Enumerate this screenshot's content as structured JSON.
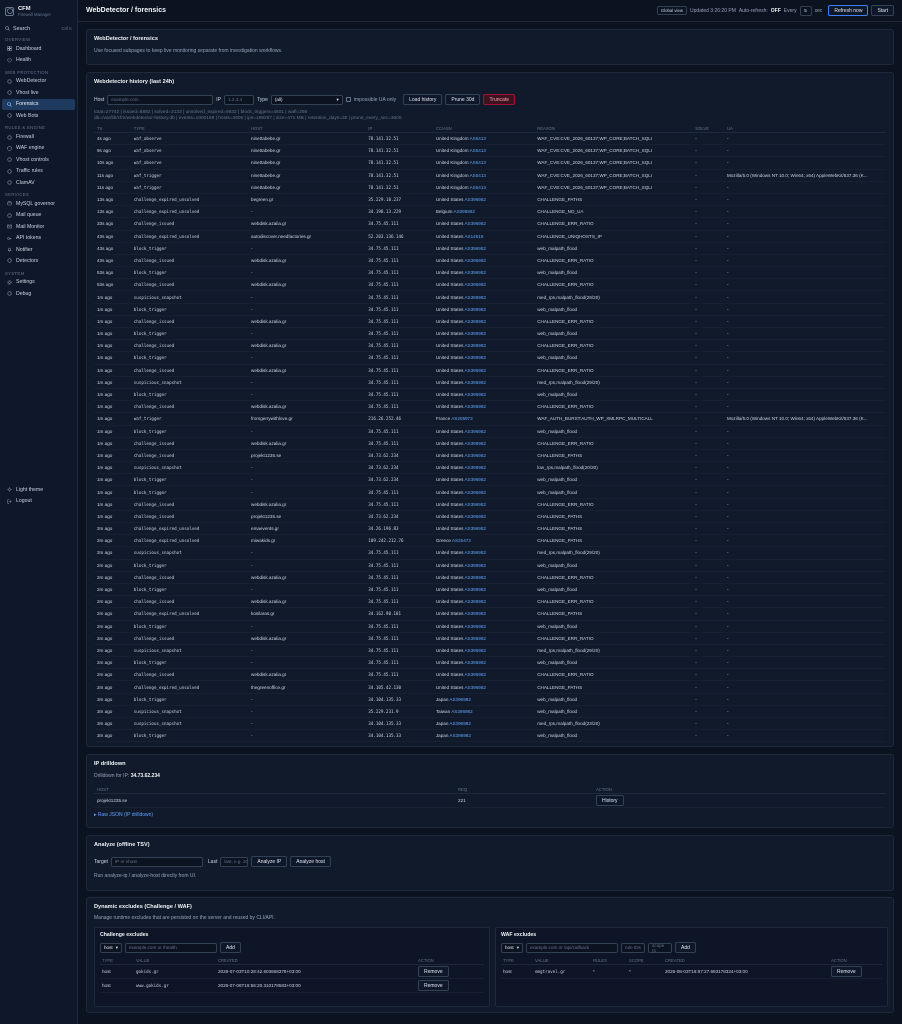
{
  "brand": {
    "title": "CFM",
    "subtitle": "Firewall Manager"
  },
  "sidebar": {
    "search_label": "Search",
    "search_kbd": "Ctrl K",
    "sections": [
      {
        "title": "Overview",
        "items": [
          {
            "label": "Dashboard",
            "icon": "grid-icon"
          },
          {
            "label": "Health",
            "icon": "heart-icon"
          }
        ]
      },
      {
        "title": "Web Protection",
        "items": [
          {
            "label": "WebDetector",
            "icon": "radar-icon"
          },
          {
            "label": "Vhost live",
            "icon": "pulse-icon"
          },
          {
            "label": "Forensics",
            "icon": "magnifier-icon",
            "active": true
          },
          {
            "label": "Web Bots",
            "icon": "bot-icon"
          }
        ]
      },
      {
        "title": "Rules & Engine",
        "items": [
          {
            "label": "Firewall",
            "icon": "flame-icon"
          },
          {
            "label": "WAF engine",
            "icon": "shield-icon"
          },
          {
            "label": "Vhost controls",
            "icon": "sliders-icon"
          },
          {
            "label": "Traffic rules",
            "icon": "route-icon"
          },
          {
            "label": "ClamAV",
            "icon": "bug-icon"
          }
        ]
      },
      {
        "title": "Services",
        "items": [
          {
            "label": "MySQL governor",
            "icon": "database-icon"
          },
          {
            "label": "Mail queue",
            "icon": "inbox-icon"
          },
          {
            "label": "Mail Monitor",
            "icon": "mail-icon"
          },
          {
            "label": "API tokens",
            "icon": "key-icon"
          },
          {
            "label": "Notifier",
            "icon": "bell-icon"
          },
          {
            "label": "Detectors",
            "icon": "target-icon"
          }
        ]
      },
      {
        "title": "System",
        "items": [
          {
            "label": "Settings",
            "icon": "gear-icon"
          },
          {
            "label": "Debug",
            "icon": "terminal-icon"
          }
        ]
      }
    ],
    "bottom": [
      {
        "label": "Light theme",
        "icon": "sun-icon"
      },
      {
        "label": "Logout",
        "icon": "logout-icon"
      }
    ]
  },
  "topbar": {
    "title": "WebDetector / forensics",
    "global_view": "Global view",
    "updated": "Updated 3:26:20 PM",
    "autorefresh_label": "Auto-refresh:",
    "autorefresh_value": "OFF",
    "every_label": "Every",
    "every_value": "5",
    "sec_label": "sec",
    "refresh_btn": "Refresh now",
    "start_btn": "Start"
  },
  "intro": {
    "title": "WebDetector / forensics",
    "text": "Use focused subpages to keep live monitoring separate from investigation workflows."
  },
  "history": {
    "title": "Webdetector history (last 24h)",
    "host_label": "Host",
    "host_placeholder": "example.com",
    "ip_label": "IP",
    "ip_placeholder": "1.2.3.4",
    "type_label": "Type",
    "type_value": "(all)",
    "impossible_label": "impossible UA only",
    "load_btn": "Load history",
    "prune_btn": "Prune 30d",
    "truncate_btn": "Truncate",
    "stats1": "total=27742 | issued=6882 | solved=3133 | unsolved_expired=9832 | block_triggers=4601 | wafl=256",
    "stats2": "db=/var/lib/cfm/webdetector-history.db | events=1000159 | hosts=3606 | ips=199257 | size=471 MB | retention_days=30 | prune_every_sec=3600",
    "columns": [
      "TS",
      "TYPE",
      "HOST",
      "IP",
      "CC/ASN",
      "REASON",
      "SOLVE",
      "UA"
    ],
    "rows": [
      [
        "4s ago",
        "waf_observe",
        "ninettabebe.gr",
        "78.141.32.51",
        "United Kingdom",
        "AS5413",
        "WAF_CVE:CVE_2026_60137;WP_CORE;BATCH_SQLI",
        "-",
        "-"
      ],
      [
        "9s ago",
        "waf_observe",
        "ninettabebe.gr",
        "78.141.32.51",
        "United Kingdom",
        "AS5413",
        "WAF_CVE:CVE_2026_60137;WP_CORE;BATCH_SQLI",
        "-",
        "-"
      ],
      [
        "10s ago",
        "waf_observe",
        "ninettabebe.gr",
        "78.141.32.51",
        "United Kingdom",
        "AS5413",
        "WAF_CVE:CVE_2026_60137;WP_CORE;BATCH_SQLI",
        "-",
        "-"
      ],
      [
        "11s ago",
        "waf_trigger",
        "ninettabebe.gr",
        "78.141.32.51",
        "United Kingdom",
        "AS5413",
        "WAF_CVE:CVE_2026_60137;WP_CORE;BATCH_SQLI",
        "-",
        "Mozilla/5.0 (Windows NT 10.0; Win64; x64) AppleWebKit/537.36 (K..."
      ],
      [
        "11s ago",
        "waf_trigger",
        "ninettabebe.gr",
        "78.141.32.51",
        "United Kingdom",
        "AS5413",
        "WAF_CVE:CVE_2026_60137;WP_CORE;BATCH_SQLI",
        "-",
        "-"
      ],
      [
        "13s ago",
        "challenge_expired_unsolved",
        "begreen.gr",
        "35.229.18.237",
        "United States",
        "AS396982",
        "CHALLENGE_PATHS",
        "-",
        "-"
      ],
      [
        "13s ago",
        "challenge_expired_unsolved",
        "-",
        "34.198.13.229",
        "Belgium",
        "AS396982",
        "CHALLENGE_NO_UA",
        "-",
        "-"
      ],
      [
        "33s ago",
        "challenge_issued",
        "webdisk.azalia.gr",
        "34.75.45.111",
        "United States",
        "AS396982",
        "CHALLENGE_ERR_RATIO",
        "-",
        "-"
      ],
      [
        "43s ago",
        "challenge_expired_unsolved",
        "autodiscover.needfactories.gr",
        "52.203.136.146",
        "United States",
        "AS14618",
        "CHALLENGE_UNIQHOSTS_IP",
        "-",
        "-"
      ],
      [
        "43s ago",
        "block_trigger",
        "-",
        "34.75.45.111",
        "United States",
        "AS396982",
        "web_malpath_flood",
        "-",
        "-"
      ],
      [
        "43s ago",
        "challenge_issued",
        "webdisk.azalia.gr",
        "34.75.45.111",
        "United States",
        "AS396982",
        "CHALLENGE_ERR_RATIO",
        "-",
        "-"
      ],
      [
        "53s ago",
        "block_trigger",
        "-",
        "34.75.45.111",
        "United States",
        "AS396982",
        "web_malpath_flood",
        "-",
        "-"
      ],
      [
        "53s ago",
        "challenge_issued",
        "webdisk.azalia.gr",
        "34.75.45.111",
        "United States",
        "AS396982",
        "CHALLENGE_ERR_RATIO",
        "-",
        "-"
      ],
      [
        "1m ago",
        "suspicious_snapshot",
        "-",
        "34.75.45.111",
        "United States",
        "AS396982",
        "med_rps,malpath_flood(29/20)",
        "-",
        "-"
      ],
      [
        "1m ago",
        "block_trigger",
        "-",
        "34.75.45.111",
        "United States",
        "AS396982",
        "web_malpath_flood",
        "-",
        "-"
      ],
      [
        "1m ago",
        "challenge_issued",
        "webdisk.azalia.gr",
        "34.75.45.111",
        "United States",
        "AS396982",
        "CHALLENGE_ERR_RATIO",
        "-",
        "-"
      ],
      [
        "1m ago",
        "block_trigger",
        "-",
        "34.75.45.111",
        "United States",
        "AS396982",
        "web_malpath_flood",
        "-",
        "-"
      ],
      [
        "1m ago",
        "challenge_issued",
        "webdisk.azalia.gr",
        "34.75.45.111",
        "United States",
        "AS396982",
        "CHALLENGE_ERR_RATIO",
        "-",
        "-"
      ],
      [
        "1m ago",
        "block_trigger",
        "-",
        "34.75.45.111",
        "United States",
        "AS396982",
        "web_malpath_flood",
        "-",
        "-"
      ],
      [
        "1m ago",
        "challenge_issued",
        "webdisk.azalia.gr",
        "34.75.45.111",
        "United States",
        "AS396982",
        "CHALLENGE_ERR_RATIO",
        "-",
        "-"
      ],
      [
        "1m ago",
        "suspicious_snapshot",
        "-",
        "34.75.45.111",
        "United States",
        "AS396982",
        "med_rps,malpath_flood(29/20)",
        "-",
        "-"
      ],
      [
        "1m ago",
        "block_trigger",
        "-",
        "34.75.45.111",
        "United States",
        "AS396982",
        "web_malpath_flood",
        "-",
        "-"
      ],
      [
        "1m ago",
        "challenge_issued",
        "webdisk.azalia.gr",
        "34.75.45.111",
        "United States",
        "AS396982",
        "CHALLENGE_ERR_RATIO",
        "-",
        "-"
      ],
      [
        "1m ago",
        "waf_trigger",
        "fromgerrywithlove.gr",
        "216.26.252.46",
        "France",
        "AS205973",
        "WAF_AUTH_BURST:AUTH_WP_XMLRPC_MULTICALL",
        "-",
        "Mozilla/5.0 (Windows NT 10.0; Win64; x64) AppleWebKit/537.36 (K..."
      ],
      [
        "1m ago",
        "block_trigger",
        "-",
        "34.75.45.111",
        "United States",
        "AS396982",
        "web_malpath_flood",
        "-",
        "-"
      ],
      [
        "1m ago",
        "challenge_issued",
        "webdisk.azalia.gr",
        "34.75.45.111",
        "United States",
        "AS396982",
        "CHALLENGE_ERR_RATIO",
        "-",
        "-"
      ],
      [
        "1m ago",
        "challenge_issued",
        "projekt1235.se",
        "34.73.62.234",
        "United States",
        "AS396982",
        "CHALLENGE_PATHS",
        "-",
        "-"
      ],
      [
        "1m ago",
        "suspicious_snapshot",
        "-",
        "34.73.62.234",
        "United States",
        "AS396982",
        "low_rps,malpath_flood(20/20)",
        "-",
        "-"
      ],
      [
        "1m ago",
        "block_trigger",
        "-",
        "34.73.62.234",
        "United States",
        "AS396982",
        "web_malpath_flood",
        "-",
        "-"
      ],
      [
        "1m ago",
        "block_trigger",
        "-",
        "34.75.45.111",
        "United States",
        "AS396982",
        "web_malpath_flood",
        "-",
        "-"
      ],
      [
        "1m ago",
        "challenge_issued",
        "webdisk.azalia.gr",
        "34.75.45.111",
        "United States",
        "AS396982",
        "CHALLENGE_ERR_RATIO",
        "-",
        "-"
      ],
      [
        "1m ago",
        "challenge_issued",
        "projekt1235.se",
        "34.73.62.234",
        "United States",
        "AS396982",
        "CHALLENGE_PATHS",
        "-",
        "-"
      ],
      [
        "2m ago",
        "challenge_expired_unsolved",
        "emaevents.gr",
        "34.26.196.83",
        "United States",
        "AS396982",
        "CHALLENGE_PATHS",
        "-",
        "-"
      ],
      [
        "2m ago",
        "challenge_expired_unsolved",
        "miwakids.gr",
        "109.242.212.76",
        "Greece",
        "AS25472",
        "CHALLENGE_PATHS",
        "-",
        "-"
      ],
      [
        "2m ago",
        "suspicious_snapshot",
        "-",
        "34.75.45.111",
        "United States",
        "AS396982",
        "med_rps,malpath_flood(29/20)",
        "-",
        "-"
      ],
      [
        "2m ago",
        "block_trigger",
        "-",
        "34.75.45.111",
        "United States",
        "AS396982",
        "web_malpath_flood",
        "-",
        "-"
      ],
      [
        "2m ago",
        "challenge_issued",
        "webdisk.azalia.gr",
        "34.75.45.111",
        "United States",
        "AS396982",
        "CHALLENGE_ERR_RATIO",
        "-",
        "-"
      ],
      [
        "2m ago",
        "block_trigger",
        "-",
        "34.75.45.111",
        "United States",
        "AS396982",
        "web_malpath_flood",
        "-",
        "-"
      ],
      [
        "2m ago",
        "challenge_issued",
        "webdisk.azalia.gr",
        "34.75.45.111",
        "United States",
        "AS396982",
        "CHALLENGE_ERR_RATIO",
        "-",
        "-"
      ],
      [
        "2m ago",
        "challenge_expired_unsolved",
        "kosilaras.gr",
        "34.162.90.181",
        "United States",
        "AS396982",
        "CHALLENGE_PATHS",
        "-",
        "-"
      ],
      [
        "2m ago",
        "block_trigger",
        "-",
        "34.75.45.111",
        "United States",
        "AS396982",
        "web_malpath_flood",
        "-",
        "-"
      ],
      [
        "2m ago",
        "challenge_issued",
        "webdisk.azalia.gr",
        "34.75.45.111",
        "United States",
        "AS396982",
        "CHALLENGE_ERR_RATIO",
        "-",
        "-"
      ],
      [
        "2m ago",
        "suspicious_snapshot",
        "-",
        "34.75.45.111",
        "United States",
        "AS396982",
        "med_rps,malpath_flood(29/20)",
        "-",
        "-"
      ],
      [
        "2m ago",
        "block_trigger",
        "-",
        "34.75.45.111",
        "United States",
        "AS396982",
        "web_malpath_flood",
        "-",
        "-"
      ],
      [
        "2m ago",
        "challenge_issued",
        "webdisk.azalia.gr",
        "34.75.45.111",
        "United States",
        "AS396982",
        "CHALLENGE_ERR_RATIO",
        "-",
        "-"
      ],
      [
        "2m ago",
        "challenge_expired_unsolved",
        "thegreenoffice.gr",
        "34.105.42.130",
        "United States",
        "AS396982",
        "CHALLENGE_PATHS",
        "-",
        "-"
      ],
      [
        "3m ago",
        "block_trigger",
        "-",
        "34.104.135.33",
        "Japan",
        "AS396982",
        "web_malpath_flood",
        "-",
        "-"
      ],
      [
        "3m ago",
        "suspicious_snapshot",
        "-",
        "35.229.231.9",
        "Taiwan",
        "AS396982",
        "web_malpath_flood",
        "-",
        "-"
      ],
      [
        "3m ago",
        "suspicious_snapshot",
        "-",
        "34.104.135.33",
        "Japan",
        "AS396982",
        "med_rps,malpath_flood(23/20)",
        "-",
        "-"
      ],
      [
        "3m ago",
        "block_trigger",
        "-",
        "34.104.135.33",
        "Japan",
        "AS396982",
        "web_malpath_flood",
        "-",
        "-"
      ]
    ]
  },
  "drill": {
    "title": "IP drilldown",
    "sub_label": "Drilldown for IP:",
    "sub_ip": "34.73.62.234",
    "columns": [
      "HOST",
      "REQ",
      "ACTION"
    ],
    "rows": [
      [
        "projekt1235.se",
        "221",
        "History"
      ]
    ],
    "raw_link": "▸ Raw JSON (IP drilldown)"
  },
  "analyze": {
    "title": "Analyze (offline TSV)",
    "target_label": "Target",
    "target_placeholder": "IP or vhost",
    "last_label": "Last",
    "last_placeholder": "last, e.g. 2000",
    "ip_btn": "Analyze IP",
    "host_btn": "Analyze host",
    "hint": "Run analyze-ip / analyze-host directly from UI."
  },
  "excludes": {
    "title": "Dynamic excludes (Challenge / WAF)",
    "desc": "Manage runtime excludes that are persisted on the server and reused by CLI/API.",
    "challenge": {
      "title": "Challenge excludes",
      "type_value": "host",
      "value_placeholder": "example.com or /health",
      "add_btn": "Add",
      "columns": [
        "TYPE",
        "VALUE",
        "CREATED",
        "ACTION"
      ],
      "rows": [
        [
          "host",
          "gokids.gr",
          "2026-07-03T10:28:42.603668378+03:00",
          "Remove"
        ],
        [
          "host",
          "www.gokids.gr",
          "2026-07-06T16:56:20.310178583+03:00",
          "Remove"
        ]
      ]
    },
    "waf": {
      "title": "WAF excludes",
      "type_value": "host",
      "value_placeholder": "example.com or /api/callback",
      "rule_placeholder": "rule IDs",
      "scope_placeholder": "scope (s",
      "add_btn": "Add",
      "columns": [
        "TYPE",
        "VALUE",
        "RULES",
        "SCOPE",
        "CREATED",
        "ACTION"
      ],
      "rows": [
        [
          "host",
          "emgtravel.gr",
          "*",
          "*",
          "2026-08-03T16:57:27.693178324+03:00",
          "Remove"
        ]
      ]
    }
  }
}
